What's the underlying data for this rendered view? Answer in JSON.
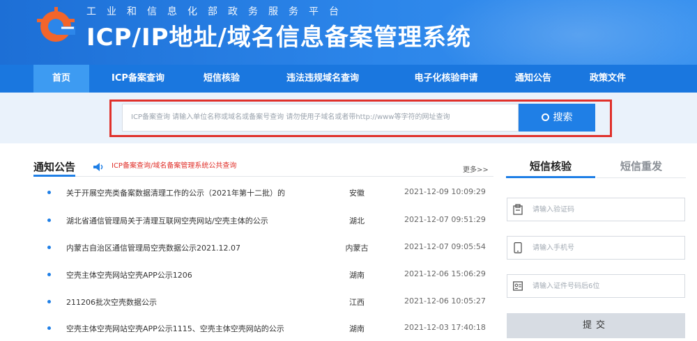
{
  "header": {
    "ministry": "工业和信息化部政务服务平台",
    "title": "ICP/IP地址/域名信息备案管理系统"
  },
  "nav": [
    "首页",
    "ICP备案查询",
    "短信核验",
    "违法违规域名查询",
    "电子化核验申请",
    "通知公告",
    "政策文件"
  ],
  "search": {
    "placeholder": "ICP备案查询  请输入单位名称或域名或备案号查询  请勿使用子域名或者带http://www等字符的网址查询",
    "button": "搜索"
  },
  "notices": {
    "title": "通知公告",
    "ticker": "ICP备案查询/域名备案管理系统公共查询",
    "more": "更多>>",
    "rows": [
      {
        "title": "关于开展空壳类备案数据清理工作的公示（2021年第十二批）的",
        "region": "安徽",
        "date": "2021-12-09 10:09:29"
      },
      {
        "title": "湖北省通信管理局关于清理互联网空壳网站/空壳主体的公示",
        "region": "湖北",
        "date": "2021-12-07 09:51:29"
      },
      {
        "title": "内蒙古自治区通信管理局空壳数据公示2021.12.07",
        "region": "内蒙古",
        "date": "2021-12-07 09:05:54"
      },
      {
        "title": "空壳主体空壳网站空壳APP公示1206",
        "region": "湖南",
        "date": "2021-12-06 15:06:29"
      },
      {
        "title": "211206批次空壳数据公示",
        "region": "江西",
        "date": "2021-12-06 10:05:27"
      },
      {
        "title": "空壳主体空壳网站空壳APP公示1115、空壳主体空壳网站的公示",
        "region": "湖南",
        "date": "2021-12-03 17:40:18"
      }
    ]
  },
  "sms": {
    "tab_active": "短信核验",
    "tab_inactive": "短信重发",
    "code_placeholder": "请输入验证码",
    "phone_placeholder": "请输入手机号",
    "id_placeholder": "请输入证件号码后6位",
    "submit": "提交"
  },
  "colors": {
    "header_blue": "#2c86ea",
    "nav_blue": "#1a77df",
    "accent": "#1f7fe6",
    "highlight_red": "#e0302a"
  }
}
